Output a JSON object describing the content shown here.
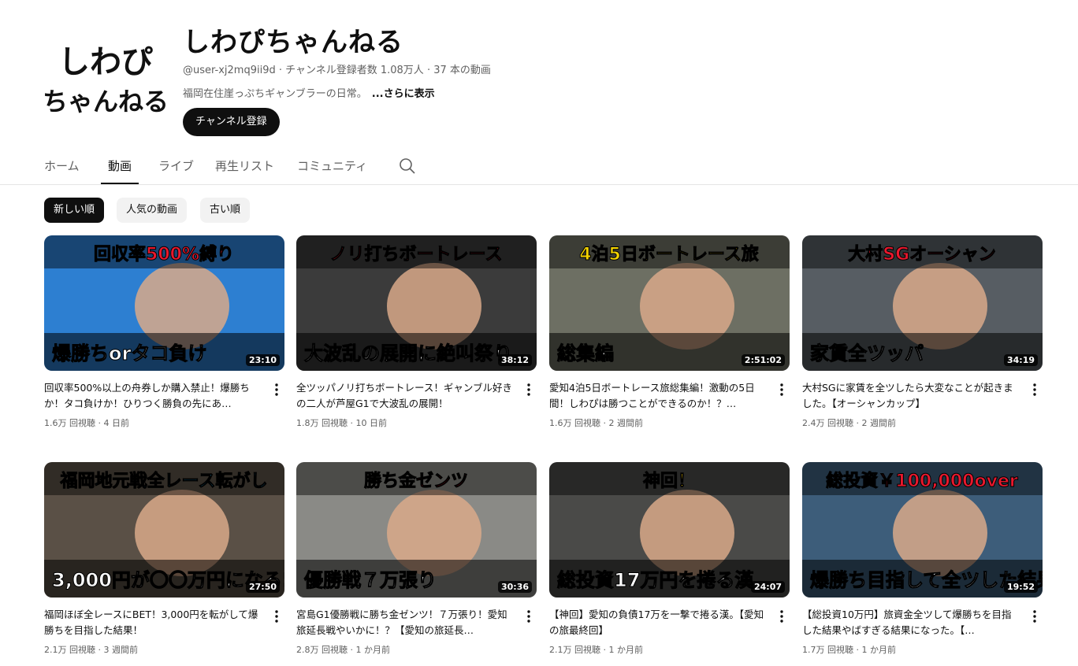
{
  "channel": {
    "logo_text": [
      "しわぴ",
      "ちゃんねる"
    ],
    "name": "しわぴちゃんねる",
    "meta": "@user-xj2mq9ii9d · チャンネル登録者数 1.08万人 · 37 本の動画",
    "description": "福岡在住崖っぷちギャンブラーの日常。",
    "more_label": "...さらに表示",
    "subscribe_label": "チャンネル登録"
  },
  "tabs": [
    "ホーム",
    "動画",
    "ライブ",
    "再生リスト",
    "コミュニティ"
  ],
  "chips": [
    "新しい順",
    "人気の動画",
    "古い順"
  ],
  "videos": [
    {
      "thumb_text": [
        "回収率500%縛り",
        "爆勝ちorタコ負け"
      ],
      "bg": "#2d7fd1",
      "accent": "#e9182d",
      "duration": "23:10",
      "title": "回収率500%以上の舟券しか購入禁止！爆勝ちか！タコ負けか！ひりつく勝負の先にあ…",
      "meta": "1.6万 回視聴 · 4 日前"
    },
    {
      "thumb_text": [
        "ノリ打ちボートレース",
        "大波乱の展開に絶叫祭り"
      ],
      "bg": "#3b3b3b",
      "accent": "#e9182d",
      "duration": "38:12",
      "title": "全ツッパノリ打ちボートレース！ギャンブル好きの二人が芦屋G1で大波乱の展開！",
      "meta": "1.8万 回視聴 · 10 日前"
    },
    {
      "thumb_text": [
        "4泊5日ボートレース旅",
        "総集編"
      ],
      "bg": "#6d6f63",
      "accent": "#f5d400",
      "duration": "2:51:02",
      "title": "愛知4泊5日ボートレース旅総集編！激動の5日間！しわぴは勝つことができるのか！？…",
      "meta": "1.6万 回視聴 · 2 週間前"
    },
    {
      "thumb_text": [
        "大村SGオーシャン",
        "家賃全ツッパ"
      ],
      "bg": "#575d63",
      "accent": "#e9182d",
      "duration": "34:19",
      "title": "大村SGに家賃を全ツしたら大変なことが起きました。【オーシャンカップ】",
      "meta": "2.4万 回視聴 · 2 週間前"
    },
    {
      "thumb_text": [
        "福岡地元戦全レース転がし",
        "3,000円が〇〇万円になる!?"
      ],
      "bg": "#5a5046",
      "accent": "#2bc4ff",
      "duration": "27:50",
      "title": "福岡ほぼ全レースにBET！3,000円を転がして爆勝ちを目指した結果！",
      "meta": "2.1万 回視聴 · 3 週間前"
    },
    {
      "thumb_text": [
        "勝ち金ゼンツ",
        "優勝戦７万張り"
      ],
      "bg": "#8a8a86",
      "accent": "#e9182d",
      "duration": "30:36",
      "title": "宮島G1優勝戦に勝ち金ゼンツ！７万張り！愛知旅延長戦やいかに！？【愛知の旅延長…",
      "meta": "2.8万 回視聴 · 1 か月前"
    },
    {
      "thumb_text": [
        "神回！",
        "総投資17万円を捲る漢"
      ],
      "bg": "#4a4a48",
      "accent": "#ffd000",
      "duration": "24:07",
      "title": "【神回】愛知の負債17万を一撃で捲る漢。【愛知の旅最終回】",
      "meta": "2.1万 回視聴 · 1 か月前"
    },
    {
      "thumb_text": [
        "総投資￥100,000over",
        "爆勝ち目指して全ツした結果。"
      ],
      "bg": "#3d5d7a",
      "accent": "#e9182d",
      "duration": "19:52",
      "title": "【総投資10万円】旅資金全ツして爆勝ちを目指した結果やばすぎる結果になった。【…",
      "meta": "1.7万 回視聴 · 1 か月前"
    }
  ]
}
